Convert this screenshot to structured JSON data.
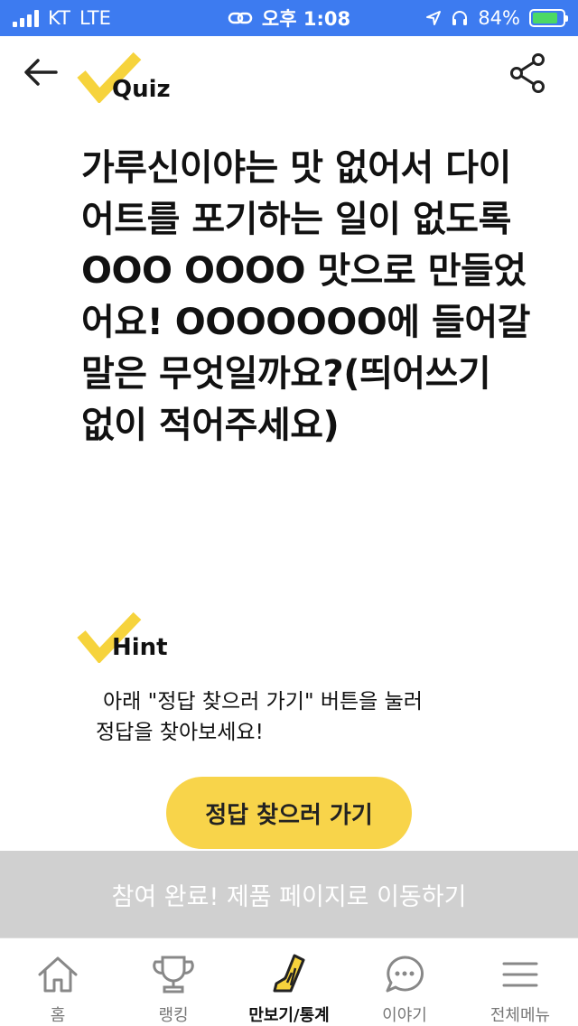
{
  "status_bar": {
    "carrier": "KT",
    "network": "LTE",
    "time": "오후 1:08",
    "battery": "84%",
    "battery_level": 0.84
  },
  "quiz": {
    "label": "Quiz",
    "question": "가루신이야는 맛 없어서 다이어트를 포기하는 일이 없도록 OOO OOOO 맛으로 만들었어요! OOOOOOO에 들어갈 말은 무엇일까요?(띄어쓰기 없이 적어주세요)"
  },
  "hint": {
    "label": "Hint",
    "line1": "아래 \"정답 찾으러 가기\" 버튼을 눌러",
    "line2": "정답을 찾아보세요!"
  },
  "answer_button": "정답 찾으러 가기",
  "complete_bar": "참여 완료! 제품 페이지로 이동하기",
  "colors": {
    "status_blue": "#3d7bf0",
    "accent_yellow": "#f8d44a",
    "check_yellow": "#f6d33c",
    "disabled_gray": "#d0d0d0"
  },
  "nav": [
    {
      "label": "홈",
      "icon": "home-icon"
    },
    {
      "label": "랭킹",
      "icon": "trophy-icon"
    },
    {
      "label": "만보기/통계",
      "icon": "shoe-icon",
      "active": true
    },
    {
      "label": "이야기",
      "icon": "chat-bubble-icon"
    },
    {
      "label": "전체메뉴",
      "icon": "hamburger-menu-icon"
    }
  ]
}
